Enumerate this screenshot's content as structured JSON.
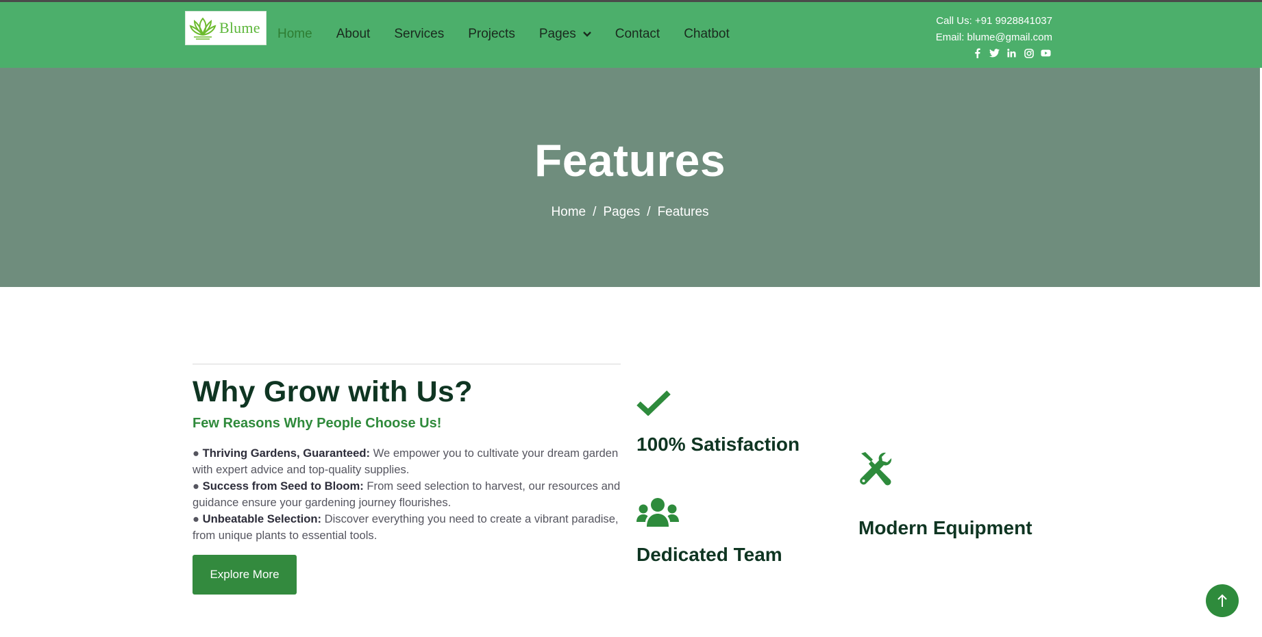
{
  "brand": {
    "name": "Blume",
    "color": "#5cb63a"
  },
  "nav": {
    "items": [
      {
        "label": "Home",
        "active": true
      },
      {
        "label": "About"
      },
      {
        "label": "Services"
      },
      {
        "label": "Projects"
      },
      {
        "label": "Pages",
        "has_dropdown": true
      },
      {
        "label": "Contact"
      },
      {
        "label": "Chatbot"
      }
    ]
  },
  "contact": {
    "phone": "Call Us: +91 9928841037",
    "email": "Email: blume@gmail.com",
    "socials": [
      "facebook-icon",
      "twitter-icon",
      "linkedin-icon",
      "instagram-icon",
      "youtube-icon"
    ]
  },
  "hero": {
    "title": "Features",
    "breadcrumb": [
      "Home",
      "Pages",
      "Features"
    ],
    "separator": "/"
  },
  "why": {
    "title": "Why Grow with Us?",
    "subtitle": "Few Reasons Why People Choose Us!",
    "points": [
      {
        "bullet": "●",
        "bold": "Thriving Gardens, Guaranteed:",
        "text": " We empower you to cultivate your dream garden with expert advice and top-quality supplies."
      },
      {
        "bullet": "●",
        "bold": "Success from Seed to Bloom:",
        "text": " From seed selection to harvest, our resources and guidance ensure your gardening journey flourishes."
      },
      {
        "bullet": "●",
        "bold": "Unbeatable Selection:",
        "text": " Discover everything you need to create a vibrant paradise, from unique plants to essential tools."
      }
    ],
    "button_label": "Explore More"
  },
  "features": [
    {
      "title": "100% Satisfaction",
      "icon": "check-icon"
    },
    {
      "title": "Dedicated Team",
      "icon": "users-icon"
    },
    {
      "title": "Modern Equipment",
      "icon": "tools-icon"
    }
  ],
  "colors": {
    "navbar": "#4caf6b",
    "hero": "#6f8d7d",
    "accent": "#338a3e",
    "heading": "#0f3522"
  }
}
